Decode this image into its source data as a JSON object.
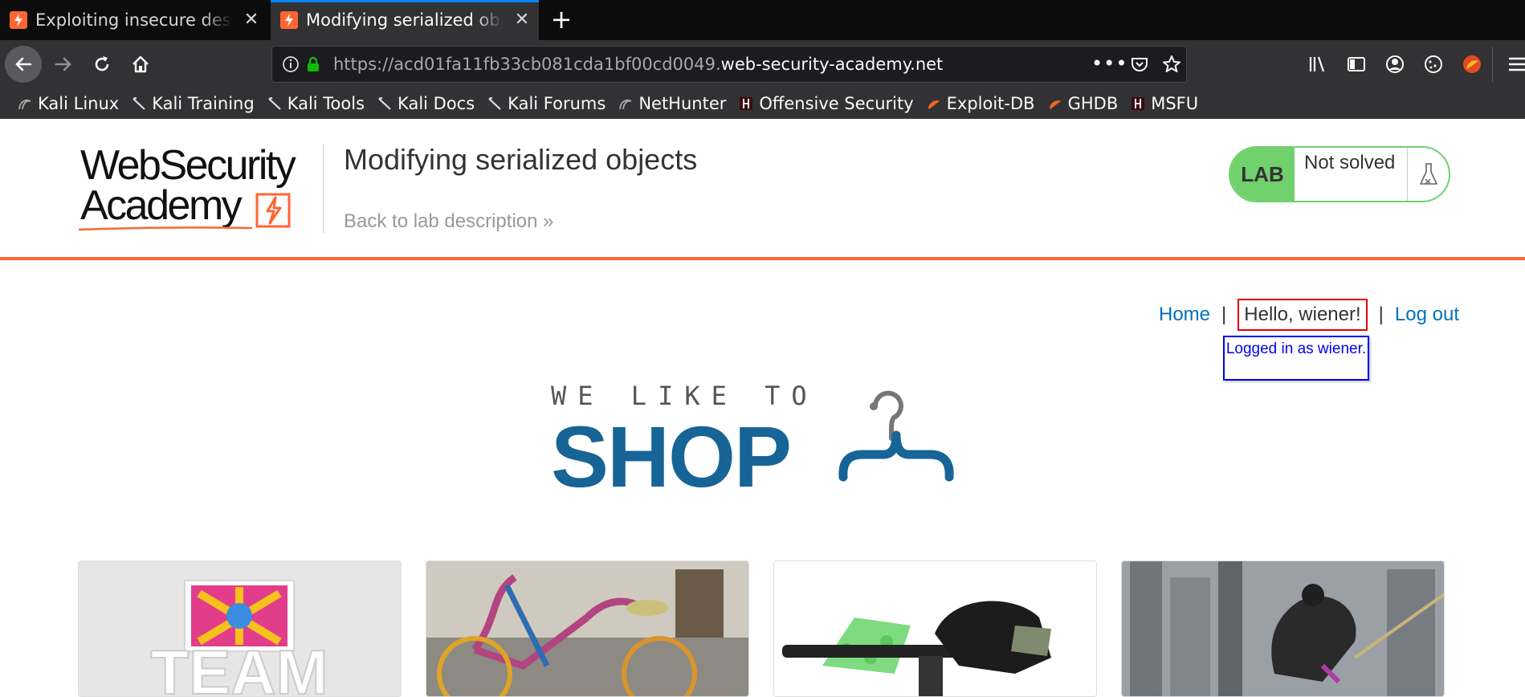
{
  "browser": {
    "tabs": [
      {
        "title": "Exploiting insecure deserialization",
        "active": false
      },
      {
        "title": "Modifying serialized objects",
        "active": true
      }
    ],
    "url_prefix": "https://acd01fa11fb33cb081cda1bf00cd0049.",
    "url_domain": "web-security-academy.net",
    "bookmarks": [
      "Kali Linux",
      "Kali Training",
      "Kali Tools",
      "Kali Docs",
      "Kali Forums",
      "NetHunter",
      "Offensive Security",
      "Exploit-DB",
      "GHDB",
      "MSFU"
    ]
  },
  "header": {
    "logo_line1": "WebSecurity",
    "logo_line2": "Academy",
    "lab_title": "Modifying serialized objects",
    "back_link": "Back to lab description",
    "lab_badge": "LAB",
    "lab_status": "Not solved"
  },
  "nav": {
    "home": "Home",
    "hello": "Hello, wiener!",
    "logout": "Log out",
    "tooltip": "Logged in as wiener."
  },
  "shop_logo": {
    "tagline": "WE LIKE TO",
    "word": "SHOP"
  },
  "colors": {
    "accent": "#ff6633",
    "link": "#0071bc",
    "lab_green": "#70d16d",
    "shop_blue": "#176496",
    "highlight_red": "#e00000",
    "tooltip_blue": "#0000ee"
  }
}
